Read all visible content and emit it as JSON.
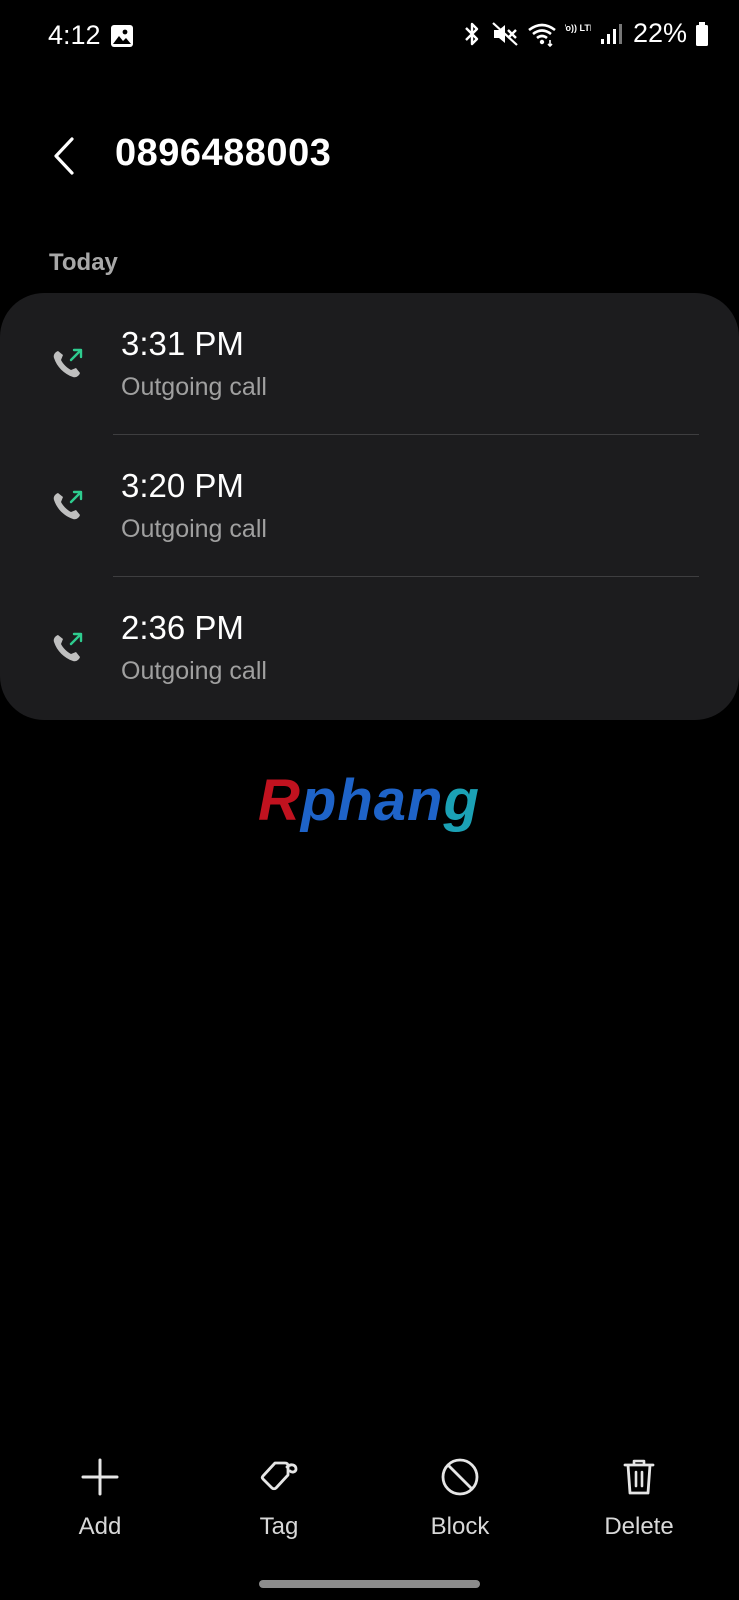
{
  "status_bar": {
    "time": "4:12",
    "lte_label": "Vo)) LTE",
    "battery_percent": "22%",
    "icons": [
      "gallery-icon",
      "bluetooth-icon",
      "mute-icon",
      "wifi-icon",
      "volte-icon",
      "signal-icon",
      "battery-icon"
    ]
  },
  "header": {
    "title": "0896488003",
    "back_icon": "chevron-left-icon"
  },
  "section": {
    "label": "Today"
  },
  "calls": [
    {
      "time": "3:31 PM",
      "type": "Outgoing call"
    },
    {
      "time": "3:20 PM",
      "type": "Outgoing call"
    },
    {
      "time": "2:36 PM",
      "type": "Outgoing call"
    }
  ],
  "watermark": {
    "part1": "R",
    "part2": "phan",
    "part3": "g"
  },
  "actions": {
    "add": "Add",
    "tag": "Tag",
    "block": "Block",
    "delete": "Delete"
  },
  "colors": {
    "background": "#000000",
    "card": "#1c1c1e",
    "outgoing_arrow": "#2ecc8f",
    "secondary_text": "#a0a0a0"
  }
}
